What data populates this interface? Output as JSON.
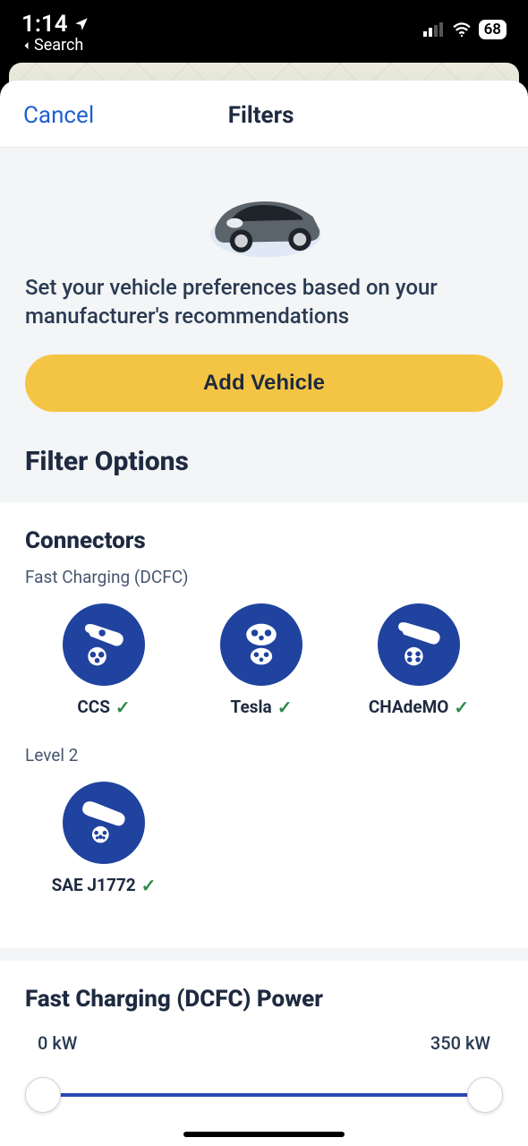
{
  "statusbar": {
    "time": "1:14",
    "back_label": "Search",
    "battery": "68"
  },
  "header": {
    "cancel": "Cancel",
    "title": "Filters"
  },
  "vehicle": {
    "prompt": "Set your vehicle preferences based on your manufacturer's recommendations",
    "add_label": "Add Vehicle"
  },
  "filter_options_title": "Filter Options",
  "connectors": {
    "title": "Connectors",
    "fast_label": "Fast Charging (DCFC)",
    "fast": [
      {
        "name": "CCS",
        "checked": true
      },
      {
        "name": "Tesla",
        "checked": true
      },
      {
        "name": "CHAdeMO",
        "checked": true
      }
    ],
    "level2_label": "Level 2",
    "level2": [
      {
        "name": "SAE J1772",
        "checked": true
      }
    ]
  },
  "power": {
    "title": "Fast Charging (DCFC) Power",
    "min_label": "0 kW",
    "max_label": "350 kW"
  }
}
